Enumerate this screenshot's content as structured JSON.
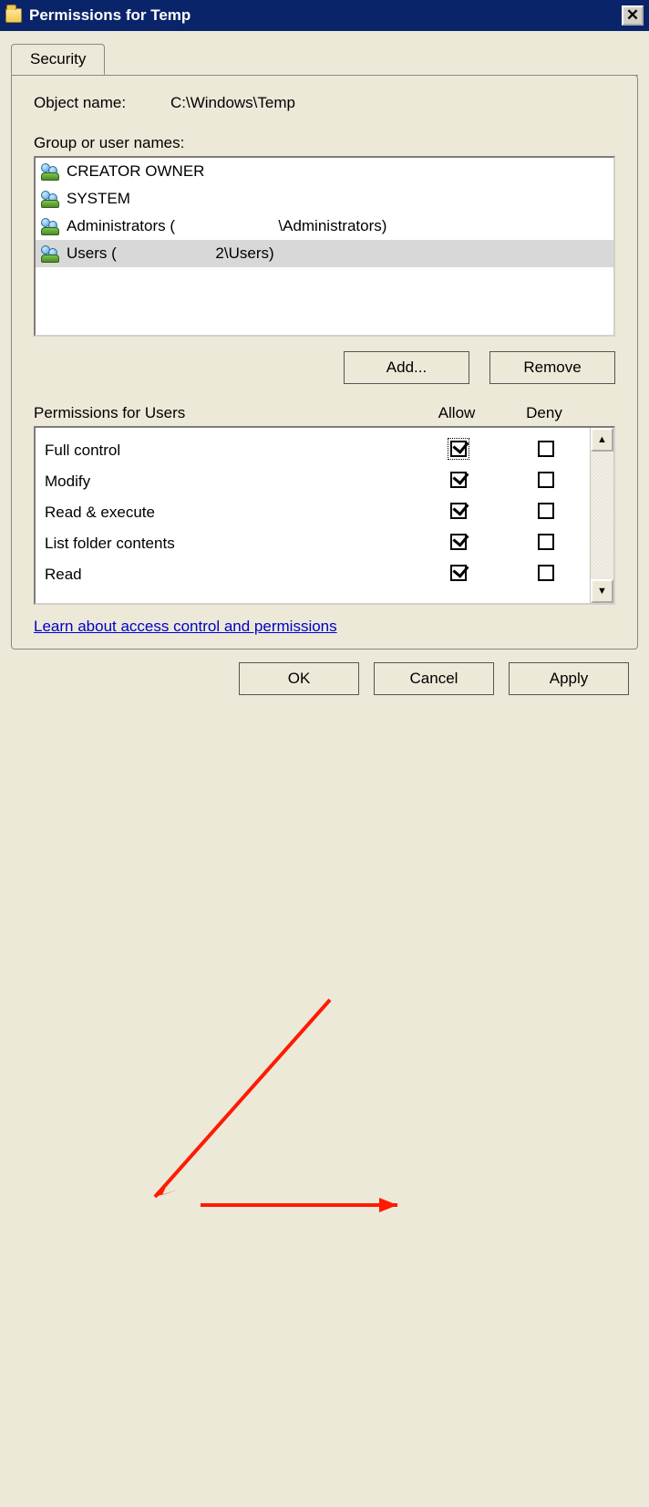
{
  "window": {
    "title": "Permissions for Temp"
  },
  "tab": {
    "label": "Security"
  },
  "object": {
    "label": "Object name:",
    "value": "C:\\Windows\\Temp"
  },
  "groups": {
    "label": "Group or user names:",
    "items": [
      {
        "text": "CREATOR OWNER",
        "selected": false
      },
      {
        "text": "SYSTEM",
        "selected": false
      },
      {
        "text": "Administrators (                        \\Administrators)",
        "selected": false
      },
      {
        "text": "Users (                       2\\Users)",
        "selected": true
      }
    ]
  },
  "buttons": {
    "add": "Add...",
    "remove": "Remove",
    "ok": "OK",
    "cancel": "Cancel",
    "apply": "Apply"
  },
  "permissions": {
    "header_label": "Permissions for Users",
    "allow_label": "Allow",
    "deny_label": "Deny",
    "rows": [
      {
        "name": "Full control",
        "allow": true,
        "deny": false,
        "focus": true
      },
      {
        "name": "Modify",
        "allow": true,
        "deny": false
      },
      {
        "name": "Read & execute",
        "allow": true,
        "deny": false
      },
      {
        "name": "List folder contents",
        "allow": true,
        "deny": false
      },
      {
        "name": "Read",
        "allow": true,
        "deny": false
      }
    ]
  },
  "link": {
    "text": "Learn about access control and permissions"
  }
}
